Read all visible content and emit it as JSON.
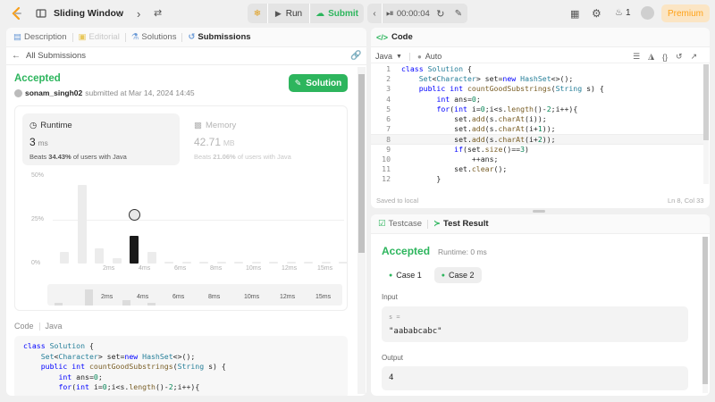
{
  "topbar": {
    "title": "Sliding Window",
    "run_label": "Run",
    "submit_label": "Submit",
    "timer": "00:00:04",
    "streak_count": "1",
    "premium_label": "Premium"
  },
  "left": {
    "tabs": [
      {
        "label": "Description"
      },
      {
        "label": "Editorial"
      },
      {
        "label": "Solutions"
      },
      {
        "label": "Submissions"
      }
    ],
    "back_label": "All Submissions",
    "status": "Accepted",
    "username": "sonam_singh02",
    "submitted_text": "submitted at Mar 14, 2024 14:45",
    "solution_button": "Solution",
    "runtime": {
      "title": "Runtime",
      "value": "3",
      "unit": "ms",
      "beats_prefix": "Beats",
      "beats_pct": "34.43%",
      "beats_suffix": "of users with Java"
    },
    "memory": {
      "title": "Memory",
      "value": "42.71",
      "unit": "MB",
      "beats_prefix": "Beats",
      "beats_pct": "21.06%",
      "beats_suffix": "of users with Java"
    },
    "code_label": "Code",
    "code_lang": "Java"
  },
  "chart_data": {
    "type": "bar",
    "y_ticks": [
      "50%",
      "25%",
      "0%"
    ],
    "x_tick_labels": [
      "2ms",
      "4ms",
      "6ms",
      "8ms",
      "10ms",
      "12ms",
      "15ms"
    ],
    "mini_x_labels": [
      "2ms",
      "4ms",
      "6ms",
      "8ms",
      "10ms",
      "12ms",
      "15ms"
    ],
    "values": [
      7,
      46,
      9,
      3,
      16,
      7,
      1,
      1,
      1,
      1,
      1,
      1,
      1,
      1,
      1,
      1,
      1,
      1,
      1,
      1,
      1,
      1,
      1,
      1,
      1
    ],
    "highlight_index": 4,
    "ylim": [
      0,
      50
    ]
  },
  "editor": {
    "header": "Code",
    "lang": "Java",
    "mode": "Auto",
    "saved_text": "Saved to local",
    "cursor_pos": "Ln 8, Col 33",
    "lines": [
      "class Solution {",
      "    Set<Character> set=new HashSet<>();",
      "    public int countGoodSubstrings(String s) {",
      "        int ans=0;",
      "        for(int i=0;i<s.length()-2;i++){",
      "            set.add(s.charAt(i));",
      "            set.add(s.charAt(i+1));",
      "            set.add(s.charAt(i+2));",
      "            if(set.size()==3)",
      "                ++ans;",
      "            set.clear();",
      "        }"
    ],
    "line_numbers": [
      "1",
      "2",
      "3",
      "4",
      "5",
      "6",
      "7",
      "8",
      "9",
      "10",
      "11",
      "12"
    ]
  },
  "left_code_lines": [
    "class Solution {",
    "    Set<Character> set=new HashSet<>();",
    "    public int countGoodSubstrings(String s) {",
    "        int ans=0;",
    "        for(int i=0;i<s.length()-2;i++){"
  ],
  "testpanel": {
    "tab_testcase": "Testcase",
    "tab_result": "Test Result",
    "status": "Accepted",
    "runtime_text": "Runtime: 0 ms",
    "cases": [
      "Case 1",
      "Case 2"
    ],
    "input_label": "Input",
    "input_var": "s =",
    "input_value": "\"aababcabc\"",
    "output_label": "Output",
    "output_value": "4"
  },
  "colors": {
    "accent_green": "#2db55d",
    "orange": "#ffa116",
    "bar_active": "#1a1a1a",
    "bar_idle": "#ececec"
  }
}
